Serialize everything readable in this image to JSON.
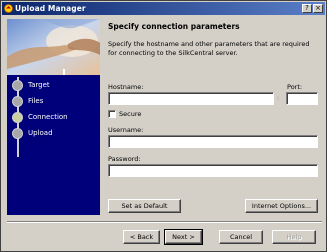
{
  "window": {
    "title": "Upload Manager",
    "help_label": "?",
    "close_label": "×"
  },
  "steps": [
    {
      "label": "Target",
      "active": false
    },
    {
      "label": "Files",
      "active": false
    },
    {
      "label": "Connection",
      "active": true
    },
    {
      "label": "Upload",
      "active": false
    }
  ],
  "main": {
    "heading": "Specify connection parameters",
    "description": "Specify the hostname and other parameters that are required for connecting to the SilkCentral server.",
    "hostname_label": "Hostname:",
    "port_label": "Port:",
    "port_separator": ":",
    "secure_label": "Secure",
    "username_label": "Username:",
    "password_label": "Password:",
    "hostname_value": "",
    "port_value": "",
    "username_value": "",
    "password_value": ""
  },
  "buttons": {
    "set_default": "Set as Default",
    "internet_options": "Internet Options...",
    "back": "< Back",
    "next": "Next >",
    "cancel": "Cancel",
    "help": "Help"
  },
  "colors": {
    "sidebar": "#00007a",
    "titlebar": "#0a246a"
  }
}
